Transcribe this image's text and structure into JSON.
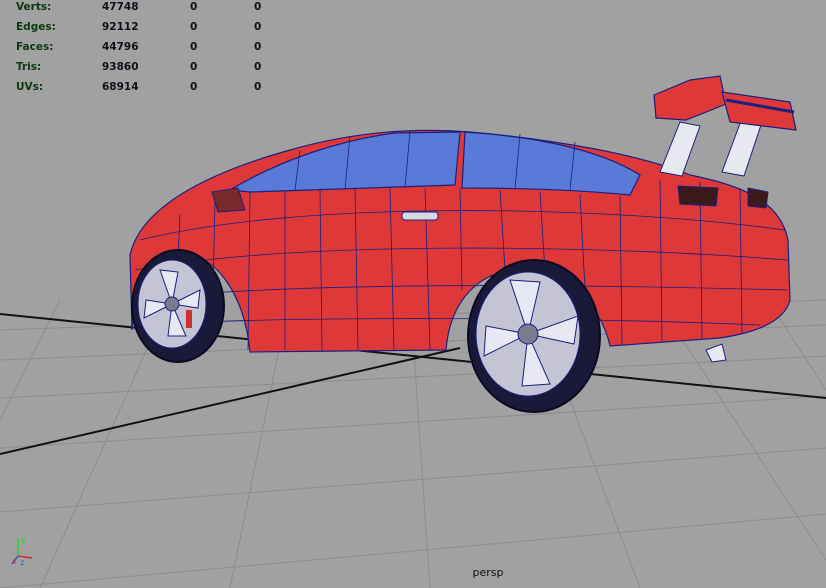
{
  "hud": {
    "rows": [
      {
        "label": "Verts:",
        "v1": "47748",
        "v2": "0",
        "v3": "0"
      },
      {
        "label": "Edges:",
        "v1": "92112",
        "v2": "0",
        "v3": "0"
      },
      {
        "label": "Faces:",
        "v1": "44796",
        "v2": "0",
        "v3": "0"
      },
      {
        "label": "Tris:",
        "v1": "93860",
        "v2": "0",
        "v3": "0"
      },
      {
        "label": "UVs:",
        "v1": "68914",
        "v2": "0",
        "v3": "0"
      }
    ]
  },
  "camera": {
    "name": "persp"
  },
  "axis": {
    "x": "x",
    "y": "y",
    "z": "z"
  },
  "colors": {
    "background": "#a1a1a1",
    "grid": "#8a8a8a",
    "grid_axis": "#111111",
    "body": "#e03a3a",
    "wire": "#1a2080",
    "glass": "#5a7ad8",
    "rim": "#b9b9c8"
  }
}
